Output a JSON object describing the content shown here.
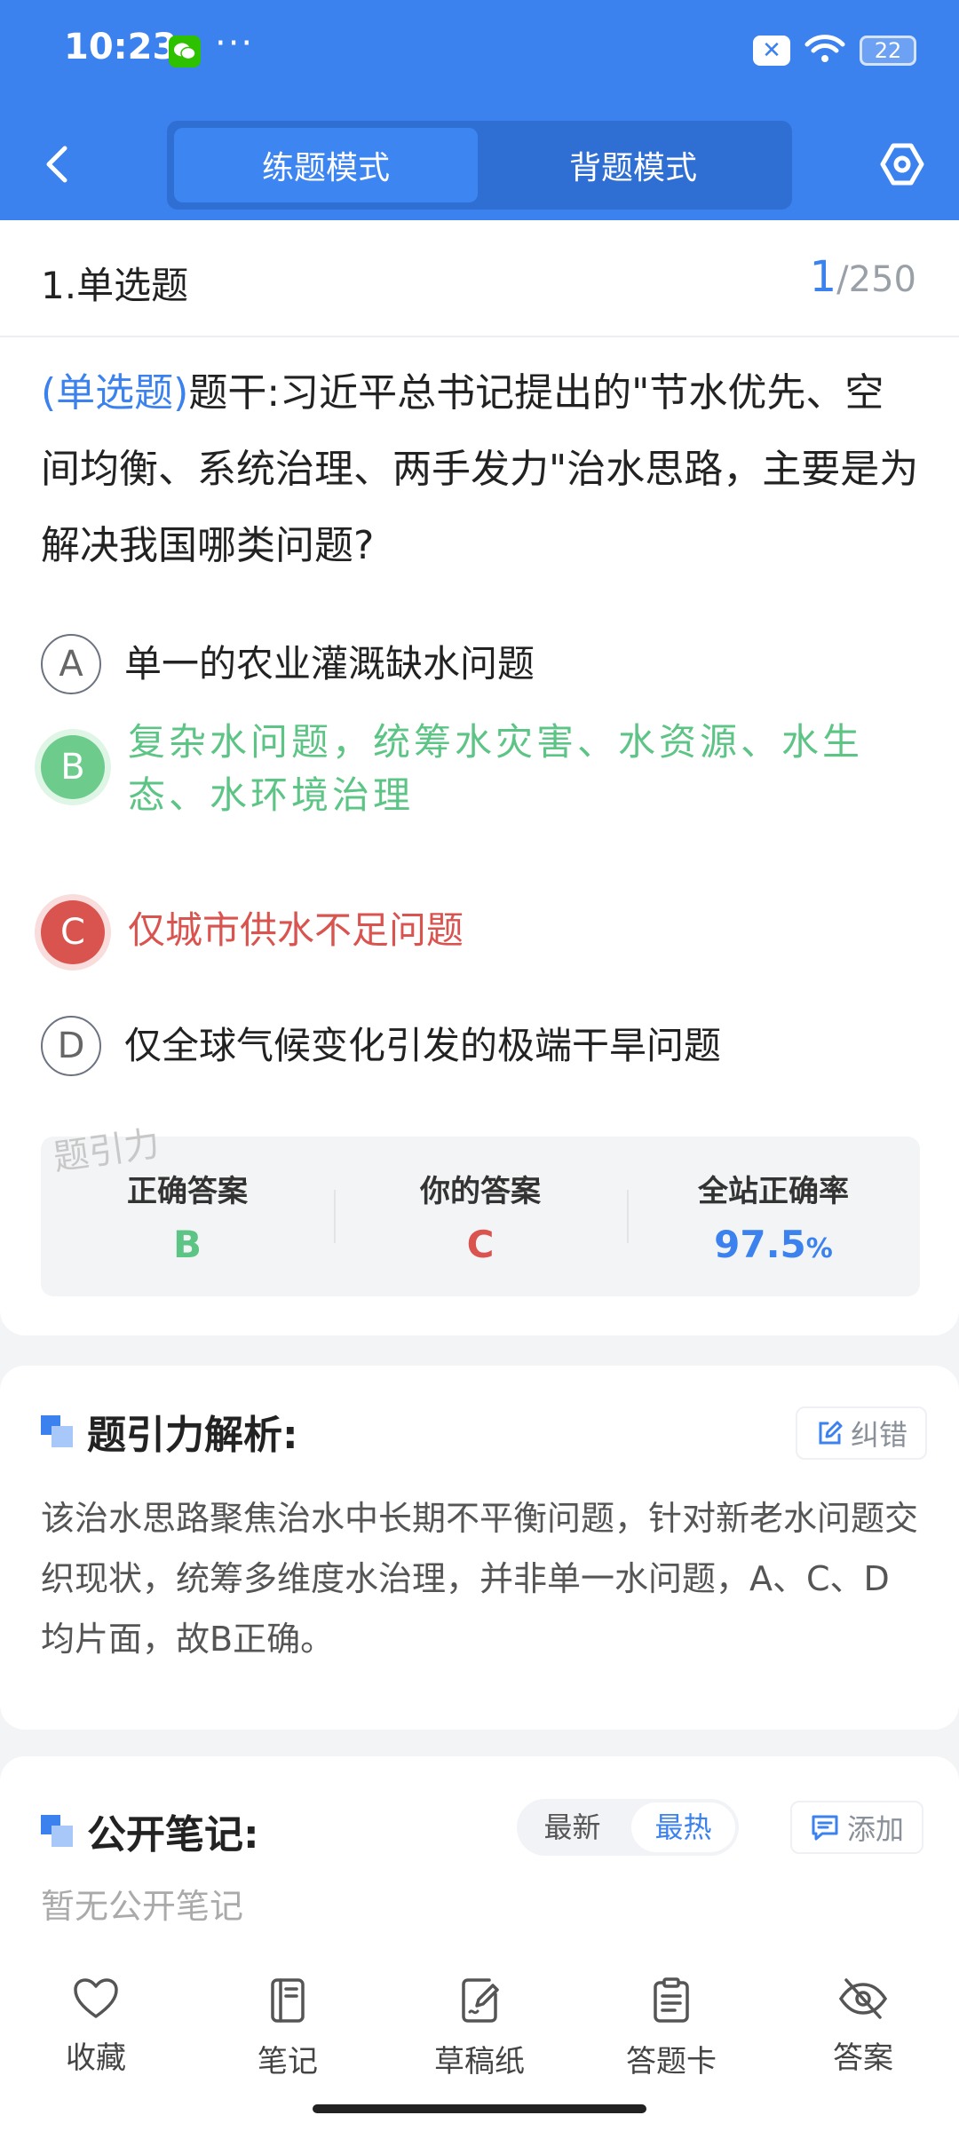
{
  "status": {
    "time": "10:23",
    "more": "···",
    "notif": "✕",
    "battery": "22"
  },
  "colors": {
    "primary": "#3b82ef",
    "correct": "#5cc485",
    "wrong": "#d9534f"
  },
  "header": {
    "back_icon": "chevron-left-icon",
    "modes": [
      {
        "label": "练题模式",
        "active": true
      },
      {
        "label": "背题模式",
        "active": false
      }
    ],
    "settings_icon": "hexagon-settings-icon"
  },
  "question": {
    "type_label": "1.单选题",
    "current": "1",
    "total": "/250",
    "tag": "(单选题)",
    "stem": "题干:习近平总书记提出的\"节水优先、空间均衡、系统治理、两手发力\"治水思路，主要是为解决我国哪类问题?",
    "options": [
      {
        "letter": "A",
        "text": "单一的农业灌溉缺水问题",
        "state": "normal"
      },
      {
        "letter": "B",
        "text": "复杂水问题，统筹水灾害、水资源、水生态、水环境治理",
        "state": "correct"
      },
      {
        "letter": "C",
        "text": "仅城市供水不足问题",
        "state": "wrong"
      },
      {
        "letter": "D",
        "text": "仅全球气候变化引发的极端干旱问题",
        "state": "normal"
      }
    ],
    "watermark": "题引力",
    "result": {
      "correct_label": "正确答案",
      "correct_value": "B",
      "yours_label": "你的答案",
      "yours_value": "C",
      "rate_label": "全站正确率",
      "rate_value": "97.5",
      "rate_unit": "%"
    }
  },
  "analysis": {
    "title": "题引力解析:",
    "report_label": "纠错",
    "text": "该治水思路聚焦治水中长期不平衡问题，针对新老水问题交织现状，统筹多维度水治理，并非单一水问题，A、C、D均片面，故B正确。"
  },
  "notes": {
    "title": "公开笔记:",
    "sort_options": [
      {
        "label": "最新",
        "active": false
      },
      {
        "label": "最热",
        "active": true
      }
    ],
    "add_label": "添加",
    "empty_text": "暂无公开笔记"
  },
  "bottom_tabs": [
    {
      "label": "收藏",
      "icon": "heart-icon"
    },
    {
      "label": "笔记",
      "icon": "notebook-icon"
    },
    {
      "label": "草稿纸",
      "icon": "draft-paper-icon"
    },
    {
      "label": "答题卡",
      "icon": "answer-sheet-icon"
    },
    {
      "label": "答案",
      "icon": "eye-off-icon"
    }
  ]
}
